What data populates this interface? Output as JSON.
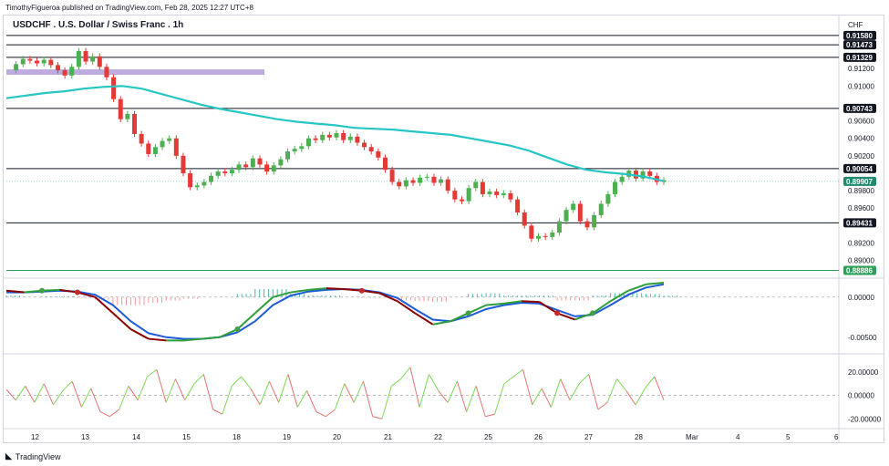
{
  "header": {
    "publisher": "TimothyFigueroa published on TradingView.com, Feb 28, 2025 12:27 UTC+8",
    "symbol": "USDCHF . U.S. Dollar / Swiss Franc . 1h",
    "currency": "CHF"
  },
  "brand": {
    "logo_text": "TradingView"
  },
  "colors": {
    "ema": "#26c6c6",
    "zone": "#b39ddb",
    "up": "#4caf50",
    "down": "#e53935",
    "macd_fast": "#2e9e3a",
    "macd_slow": "#1e5bd8",
    "osc_up": "#7ed957",
    "osc_down": "#e57373"
  },
  "chart_data": [
    {
      "type": "candlestick",
      "title": "USDCHF . U.S. Dollar / Swiss Franc . 1h",
      "ylim": [
        0.8885,
        0.9162
      ],
      "y_ticks": [
        "0.91200",
        "0.91000",
        "0.90600",
        "0.90400",
        "0.90200",
        "0.89800",
        "0.89600",
        "0.89200",
        "0.89000"
      ],
      "x_ticks": [
        "12",
        "13",
        "14",
        "15",
        "18",
        "19",
        "20",
        "21",
        "22",
        "25",
        "26",
        "27",
        "28",
        "Mar",
        "4",
        "5",
        "6"
      ],
      "horizontal_levels": [
        {
          "label": "0.91580",
          "value": 0.9158,
          "color": "#131722"
        },
        {
          "label": "0.91473",
          "value": 0.91473,
          "color": "#131722"
        },
        {
          "label": "0.91329",
          "value": 0.91329,
          "color": "#131722"
        },
        {
          "label": "0.90743",
          "value": 0.90743,
          "color": "#131722"
        },
        {
          "label": "0.90054",
          "value": 0.90054,
          "color": "#131722"
        },
        {
          "label": "0.89431",
          "value": 0.89431,
          "color": "#131722"
        },
        {
          "label": "0.88886",
          "value": 0.88886,
          "color": "#2e9e56"
        }
      ],
      "last_price": {
        "label": "0.89907",
        "value": 0.89907
      },
      "zone": {
        "from": 0.9111,
        "to": 0.9117
      },
      "close_series": [
        0.9118,
        0.9125,
        0.9131,
        0.9129,
        0.9126,
        0.913,
        0.9124,
        0.9118,
        0.9112,
        0.9122,
        0.914,
        0.9128,
        0.9134,
        0.9122,
        0.911,
        0.9085,
        0.9062,
        0.9068,
        0.9045,
        0.9034,
        0.9022,
        0.903,
        0.9037,
        0.904,
        0.902,
        0.9,
        0.8984,
        0.8986,
        0.899,
        0.8997,
        0.9002,
        0.9,
        0.9004,
        0.901,
        0.9007,
        0.9017,
        0.901,
        0.9002,
        0.9009,
        0.9016,
        0.9025,
        0.9028,
        0.9031,
        0.904,
        0.9038,
        0.9044,
        0.9041,
        0.9046,
        0.9038,
        0.9042,
        0.9035,
        0.903,
        0.9025,
        0.9018,
        0.9004,
        0.899,
        0.8985,
        0.8992,
        0.8989,
        0.8995,
        0.8996,
        0.8989,
        0.8993,
        0.898,
        0.897,
        0.8968,
        0.8983,
        0.899,
        0.8976,
        0.8979,
        0.8975,
        0.8977,
        0.897,
        0.8955,
        0.894,
        0.8925,
        0.8928,
        0.8927,
        0.8932,
        0.8945,
        0.8958,
        0.8965,
        0.8945,
        0.8938,
        0.8952,
        0.8965,
        0.8976,
        0.899,
        0.8996,
        0.9003,
        0.8994,
        0.9002,
        0.8997,
        0.899,
        0.8992
      ],
      "ema_series": [
        0.9086,
        0.9089,
        0.9092,
        0.9094,
        0.9097,
        0.9099,
        0.91,
        0.9097,
        0.9091,
        0.9085,
        0.9079,
        0.9074,
        0.907,
        0.9066,
        0.9062,
        0.9059,
        0.9057,
        0.9055,
        0.9052,
        0.9051,
        0.905,
        0.9048,
        0.9046,
        0.9044,
        0.904,
        0.9036,
        0.9032,
        0.9026,
        0.9018,
        0.901,
        0.9004,
        0.9001,
        0.8999,
        0.8996,
        0.8991
      ],
      "series": [
        {
          "name": "",
          "values": []
        }
      ]
    },
    {
      "type": "histogram+line",
      "ylim": [
        -0.0065,
        0.0018
      ],
      "y_ticks": [
        "0.00000",
        "-0.00500"
      ],
      "fast": [
        0.0008,
        0.0006,
        0.0008,
        0.0009,
        0.0006,
        0.0,
        -0.002,
        -0.004,
        -0.0052,
        -0.0054,
        -0.0054,
        -0.0052,
        -0.005,
        -0.004,
        -0.002,
        0.0,
        0.0006,
        0.0009,
        0.0011,
        0.001,
        0.0008,
        0.0005,
        -0.0005,
        -0.002,
        -0.0034,
        -0.003,
        -0.002,
        -0.001,
        -0.0008,
        -0.0005,
        -0.0006,
        -0.002,
        -0.0028,
        -0.002,
        -0.0005,
        0.0008,
        0.0016,
        0.0018
      ],
      "slow": [
        0.0006,
        0.0006,
        0.0007,
        0.0008,
        0.0007,
        0.0003,
        -0.001,
        -0.003,
        -0.0045,
        -0.005,
        -0.0052,
        -0.0052,
        -0.005,
        -0.0044,
        -0.003,
        -0.001,
        0.0002,
        0.0007,
        0.0009,
        0.001,
        0.0009,
        0.0006,
        -0.0001,
        -0.0015,
        -0.0028,
        -0.003,
        -0.0024,
        -0.0015,
        -0.001,
        -0.0007,
        -0.0008,
        -0.0016,
        -0.0024,
        -0.0022,
        -0.001,
        0.0003,
        0.0012,
        0.0016
      ],
      "histogram": [
        0.0002,
        0.0,
        0.0001,
        0.0001,
        -0.0001,
        -0.0003,
        -0.001,
        -0.001,
        -0.0007,
        -0.0004,
        -0.0002,
        0.0,
        0.0,
        0.0004,
        0.001,
        0.001,
        0.0004,
        0.0002,
        0.0002,
        0.0,
        -0.0001,
        -0.0001,
        -0.0004,
        -0.0005,
        -0.0006,
        0.0,
        0.0004,
        0.0005,
        0.0002,
        0.0002,
        0.0002,
        -0.0004,
        -0.0004,
        0.0002,
        0.0005,
        0.0005,
        0.0004,
        0.0002
      ]
    },
    {
      "type": "line",
      "ylim": [
        -26,
        30
      ],
      "y_ticks": [
        "20.00000",
        "0.00000",
        "-20.00000"
      ],
      "values": [
        5,
        -4,
        8,
        -6,
        10,
        -8,
        4,
        12,
        -10,
        6,
        -14,
        -18,
        -12,
        8,
        -4,
        16,
        22,
        -6,
        14,
        -4,
        10,
        18,
        -12,
        -16,
        8,
        16,
        6,
        -8,
        12,
        -6,
        18,
        -10,
        4,
        -14,
        -18,
        -12,
        10,
        -6,
        12,
        -18,
        -20,
        8,
        14,
        24,
        -10,
        18,
        4,
        -6,
        12,
        -14,
        8,
        -18,
        -16,
        10,
        16,
        22,
        -8,
        6,
        -10,
        14,
        -4,
        10,
        18,
        -12,
        -6,
        14,
        4,
        -8,
        6,
        16,
        -4
      ]
    }
  ]
}
